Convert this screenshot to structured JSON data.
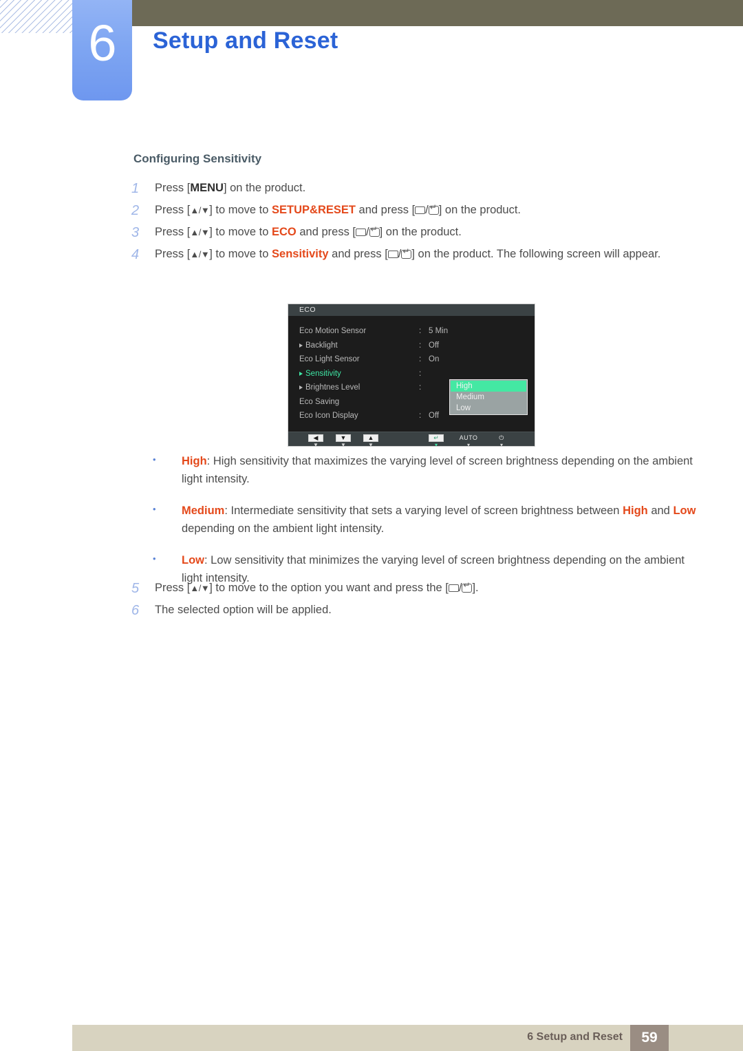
{
  "header": {
    "chapter_number": "6",
    "chapter_title": "Setup and Reset"
  },
  "section": {
    "heading": "Configuring Sensitivity"
  },
  "steps": [
    {
      "num": "1",
      "parts": [
        {
          "t": "Press [",
          "style": "normal"
        },
        {
          "t": "MENU",
          "style": "dark"
        },
        {
          "t": "] on the product.",
          "style": "normal"
        }
      ]
    },
    {
      "num": "2",
      "parts": [
        {
          "t": "Press [",
          "style": "normal"
        },
        {
          "t": "arrows",
          "style": "arrows"
        },
        {
          "t": "] to move to ",
          "style": "normal"
        },
        {
          "t": "SETUP&RESET",
          "style": "red"
        },
        {
          "t": " and press [",
          "style": "normal"
        },
        {
          "t": "keys",
          "style": "keys"
        },
        {
          "t": "] on the product.",
          "style": "normal"
        }
      ]
    },
    {
      "num": "3",
      "parts": [
        {
          "t": "Press [",
          "style": "normal"
        },
        {
          "t": "arrows",
          "style": "arrows"
        },
        {
          "t": "] to move to ",
          "style": "normal"
        },
        {
          "t": "ECO",
          "style": "red"
        },
        {
          "t": " and press [",
          "style": "normal"
        },
        {
          "t": "keys",
          "style": "keys"
        },
        {
          "t": "] on the product.",
          "style": "normal"
        }
      ]
    },
    {
      "num": "4",
      "parts": [
        {
          "t": "Press [",
          "style": "normal"
        },
        {
          "t": "arrows",
          "style": "arrows"
        },
        {
          "t": "] to move to ",
          "style": "normal"
        },
        {
          "t": "Sensitivity",
          "style": "red"
        },
        {
          "t": " and press [",
          "style": "normal"
        },
        {
          "t": "keys",
          "style": "keys"
        },
        {
          "t": "] on the product. The following screen will appear.",
          "style": "normal"
        }
      ]
    }
  ],
  "steps_after": [
    {
      "num": "5",
      "parts": [
        {
          "t": "Press [",
          "style": "normal"
        },
        {
          "t": "arrows",
          "style": "arrows"
        },
        {
          "t": "] to move to the option you want and press the [",
          "style": "normal"
        },
        {
          "t": "keys",
          "style": "keys"
        },
        {
          "t": "].",
          "style": "normal"
        }
      ]
    },
    {
      "num": "6",
      "parts": [
        {
          "t": "The selected option will be applied.",
          "style": "normal"
        }
      ]
    }
  ],
  "osd": {
    "title": "ECO",
    "rows": [
      {
        "label": "Eco Motion Sensor",
        "arrow": false,
        "colon": ":",
        "value": "5 Min",
        "selected": false
      },
      {
        "label": "Backlight",
        "arrow": true,
        "colon": ":",
        "value": "Off",
        "selected": false
      },
      {
        "label": "Eco Light Sensor",
        "arrow": false,
        "colon": ":",
        "value": "On",
        "selected": false
      },
      {
        "label": "Sensitivity",
        "arrow": true,
        "colon": ":",
        "value": "",
        "selected": true
      },
      {
        "label": "Brightnes Level",
        "arrow": true,
        "colon": ":",
        "value": "",
        "selected": false
      },
      {
        "label": "Eco Saving",
        "arrow": false,
        "colon": "",
        "value": "",
        "selected": false
      },
      {
        "label": "Eco Icon Display",
        "arrow": false,
        "colon": ":",
        "value": "Off",
        "selected": false
      }
    ],
    "dropdown": {
      "items": [
        "High",
        "Medium",
        "Low"
      ],
      "active_index": 0
    },
    "footer_buttons": [
      {
        "name": "left-arrow-button",
        "glyph": "◀",
        "kind": "box",
        "caption": "▼",
        "green": false
      },
      {
        "name": "down-arrow-button",
        "glyph": "▼",
        "kind": "box",
        "caption": "▼",
        "green": false
      },
      {
        "name": "up-arrow-button",
        "glyph": "▲",
        "kind": "box",
        "caption": "▼",
        "green": false
      },
      {
        "name": "enter-button",
        "glyph": "↵",
        "kind": "box",
        "caption": "▾",
        "green": true
      },
      {
        "name": "auto-button",
        "glyph": "AUTO",
        "kind": "text",
        "caption": "▾",
        "green": false
      },
      {
        "name": "power-button",
        "glyph": "⏻",
        "kind": "text",
        "caption": "▾",
        "green": false
      }
    ],
    "colors": {
      "accent_green": "#3fe6a5",
      "background": "#1c1c1c",
      "titlebar": "#3b4244"
    }
  },
  "bullets": [
    {
      "marker": "•",
      "parts": [
        {
          "t": "High",
          "style": "red"
        },
        {
          "t": ": High sensitivity that maximizes the varying level of screen brightness depending on the ambient light intensity.",
          "style": "normal"
        }
      ]
    },
    {
      "marker": "•",
      "parts": [
        {
          "t": "Medium",
          "style": "red"
        },
        {
          "t": ": Intermediate sensitivity that sets a varying level of screen brightness between ",
          "style": "normal"
        },
        {
          "t": "High",
          "style": "red"
        },
        {
          "t": " and ",
          "style": "normal"
        },
        {
          "t": "Low",
          "style": "red"
        },
        {
          "t": " depending on the ambient light intensity.",
          "style": "normal"
        }
      ]
    },
    {
      "marker": "•",
      "parts": [
        {
          "t": "Low",
          "style": "red"
        },
        {
          "t": ": Low sensitivity that minimizes the varying level of screen brightness depending on the ambient light intensity.",
          "style": "normal"
        }
      ]
    }
  ],
  "footer": {
    "text": "6 Setup and Reset",
    "page_number": "59"
  }
}
